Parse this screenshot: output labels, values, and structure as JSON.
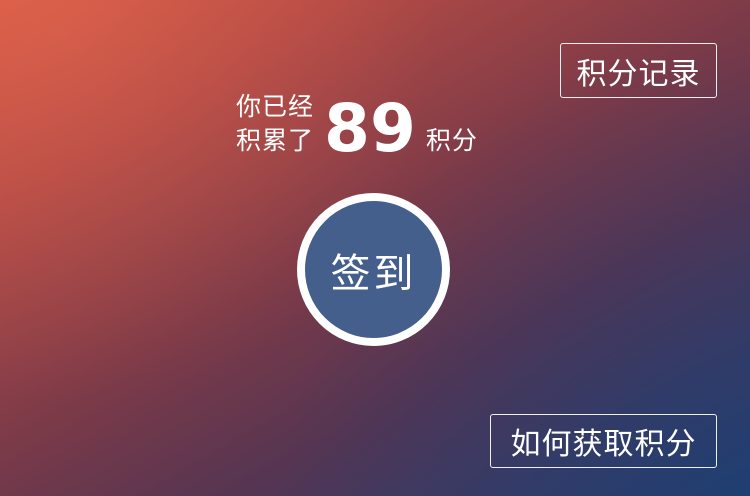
{
  "header": {
    "records_label": "积分记录"
  },
  "points": {
    "line1": "你已经",
    "line2": "积累了",
    "value": "89",
    "unit": "积分"
  },
  "checkin": {
    "label": "签到"
  },
  "footer": {
    "how_to_label": "如何获取积分"
  },
  "colors": {
    "gradient_start": "#d45a45",
    "gradient_end": "#25406e",
    "checkin_fill": "#455f8c",
    "text": "#ffffff"
  }
}
